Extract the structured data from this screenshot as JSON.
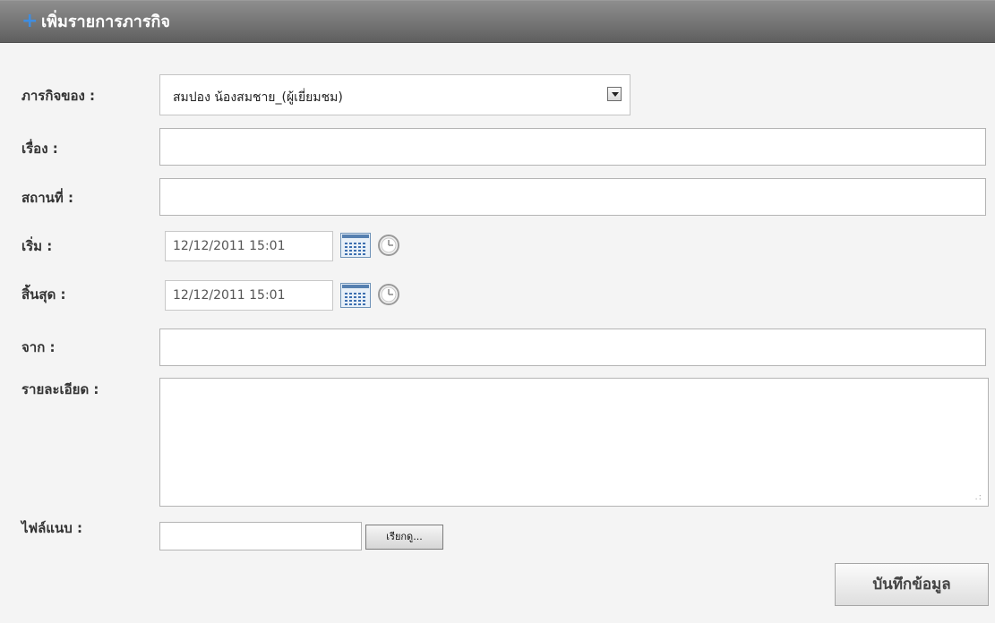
{
  "header": {
    "title": "เพิ่มรายการภารกิจ",
    "plus_icon": "plus-icon"
  },
  "form": {
    "owner": {
      "label": "ภารกิจของ :",
      "value": "สมปอง น้องสมชาย_(ผู้เยี่ยมชม)"
    },
    "subject": {
      "label": "เรื่อง :",
      "value": ""
    },
    "location": {
      "label": "สถานที่ :",
      "value": ""
    },
    "start": {
      "label": "เริ่ม :",
      "value": "12/12/2011 15:01"
    },
    "end": {
      "label": "สิ้นสุด :",
      "value": "12/12/2011 15:01"
    },
    "from": {
      "label": "จาก :",
      "value": ""
    },
    "details": {
      "label": "รายละเอียด :",
      "value": ""
    },
    "attachment": {
      "label": "ไฟล์แนบ :",
      "browse_label": "เรียกดู..."
    },
    "save_label": "บันทึกข้อมูล"
  },
  "colors": {
    "header_bg": "#707070",
    "accent_plus": "#3f8de0",
    "panel_bg": "#f4f4f4"
  }
}
